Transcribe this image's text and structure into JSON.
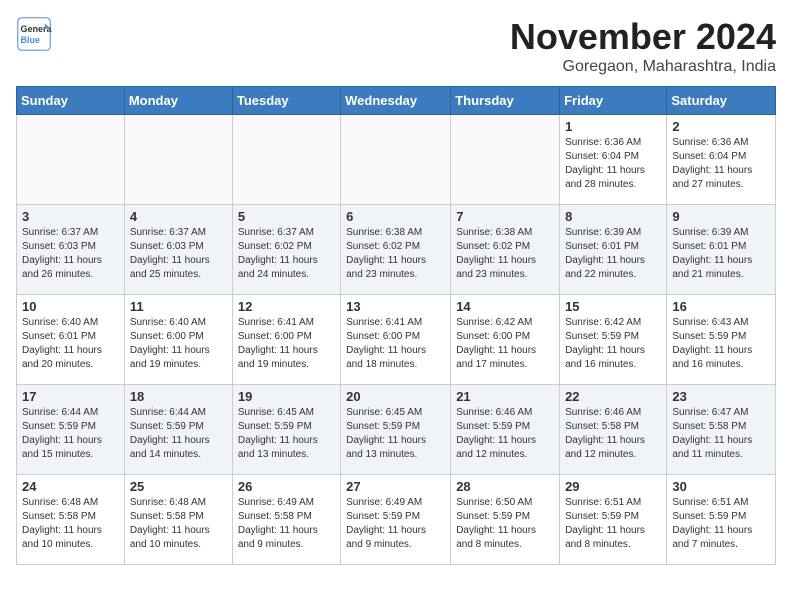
{
  "logo": {
    "line1": "General",
    "line2": "Blue"
  },
  "title": "November 2024",
  "location": "Goregaon, Maharashtra, India",
  "days_of_week": [
    "Sunday",
    "Monday",
    "Tuesday",
    "Wednesday",
    "Thursday",
    "Friday",
    "Saturday"
  ],
  "weeks": [
    [
      {
        "day": "",
        "info": ""
      },
      {
        "day": "",
        "info": ""
      },
      {
        "day": "",
        "info": ""
      },
      {
        "day": "",
        "info": ""
      },
      {
        "day": "",
        "info": ""
      },
      {
        "day": "1",
        "info": "Sunrise: 6:36 AM\nSunset: 6:04 PM\nDaylight: 11 hours and 28 minutes."
      },
      {
        "day": "2",
        "info": "Sunrise: 6:36 AM\nSunset: 6:04 PM\nDaylight: 11 hours and 27 minutes."
      }
    ],
    [
      {
        "day": "3",
        "info": "Sunrise: 6:37 AM\nSunset: 6:03 PM\nDaylight: 11 hours and 26 minutes."
      },
      {
        "day": "4",
        "info": "Sunrise: 6:37 AM\nSunset: 6:03 PM\nDaylight: 11 hours and 25 minutes."
      },
      {
        "day": "5",
        "info": "Sunrise: 6:37 AM\nSunset: 6:02 PM\nDaylight: 11 hours and 24 minutes."
      },
      {
        "day": "6",
        "info": "Sunrise: 6:38 AM\nSunset: 6:02 PM\nDaylight: 11 hours and 23 minutes."
      },
      {
        "day": "7",
        "info": "Sunrise: 6:38 AM\nSunset: 6:02 PM\nDaylight: 11 hours and 23 minutes."
      },
      {
        "day": "8",
        "info": "Sunrise: 6:39 AM\nSunset: 6:01 PM\nDaylight: 11 hours and 22 minutes."
      },
      {
        "day": "9",
        "info": "Sunrise: 6:39 AM\nSunset: 6:01 PM\nDaylight: 11 hours and 21 minutes."
      }
    ],
    [
      {
        "day": "10",
        "info": "Sunrise: 6:40 AM\nSunset: 6:01 PM\nDaylight: 11 hours and 20 minutes."
      },
      {
        "day": "11",
        "info": "Sunrise: 6:40 AM\nSunset: 6:00 PM\nDaylight: 11 hours and 19 minutes."
      },
      {
        "day": "12",
        "info": "Sunrise: 6:41 AM\nSunset: 6:00 PM\nDaylight: 11 hours and 19 minutes."
      },
      {
        "day": "13",
        "info": "Sunrise: 6:41 AM\nSunset: 6:00 PM\nDaylight: 11 hours and 18 minutes."
      },
      {
        "day": "14",
        "info": "Sunrise: 6:42 AM\nSunset: 6:00 PM\nDaylight: 11 hours and 17 minutes."
      },
      {
        "day": "15",
        "info": "Sunrise: 6:42 AM\nSunset: 5:59 PM\nDaylight: 11 hours and 16 minutes."
      },
      {
        "day": "16",
        "info": "Sunrise: 6:43 AM\nSunset: 5:59 PM\nDaylight: 11 hours and 16 minutes."
      }
    ],
    [
      {
        "day": "17",
        "info": "Sunrise: 6:44 AM\nSunset: 5:59 PM\nDaylight: 11 hours and 15 minutes."
      },
      {
        "day": "18",
        "info": "Sunrise: 6:44 AM\nSunset: 5:59 PM\nDaylight: 11 hours and 14 minutes."
      },
      {
        "day": "19",
        "info": "Sunrise: 6:45 AM\nSunset: 5:59 PM\nDaylight: 11 hours and 13 minutes."
      },
      {
        "day": "20",
        "info": "Sunrise: 6:45 AM\nSunset: 5:59 PM\nDaylight: 11 hours and 13 minutes."
      },
      {
        "day": "21",
        "info": "Sunrise: 6:46 AM\nSunset: 5:59 PM\nDaylight: 11 hours and 12 minutes."
      },
      {
        "day": "22",
        "info": "Sunrise: 6:46 AM\nSunset: 5:58 PM\nDaylight: 11 hours and 12 minutes."
      },
      {
        "day": "23",
        "info": "Sunrise: 6:47 AM\nSunset: 5:58 PM\nDaylight: 11 hours and 11 minutes."
      }
    ],
    [
      {
        "day": "24",
        "info": "Sunrise: 6:48 AM\nSunset: 5:58 PM\nDaylight: 11 hours and 10 minutes."
      },
      {
        "day": "25",
        "info": "Sunrise: 6:48 AM\nSunset: 5:58 PM\nDaylight: 11 hours and 10 minutes."
      },
      {
        "day": "26",
        "info": "Sunrise: 6:49 AM\nSunset: 5:58 PM\nDaylight: 11 hours and 9 minutes."
      },
      {
        "day": "27",
        "info": "Sunrise: 6:49 AM\nSunset: 5:59 PM\nDaylight: 11 hours and 9 minutes."
      },
      {
        "day": "28",
        "info": "Sunrise: 6:50 AM\nSunset: 5:59 PM\nDaylight: 11 hours and 8 minutes."
      },
      {
        "day": "29",
        "info": "Sunrise: 6:51 AM\nSunset: 5:59 PM\nDaylight: 11 hours and 8 minutes."
      },
      {
        "day": "30",
        "info": "Sunrise: 6:51 AM\nSunset: 5:59 PM\nDaylight: 11 hours and 7 minutes."
      }
    ]
  ]
}
